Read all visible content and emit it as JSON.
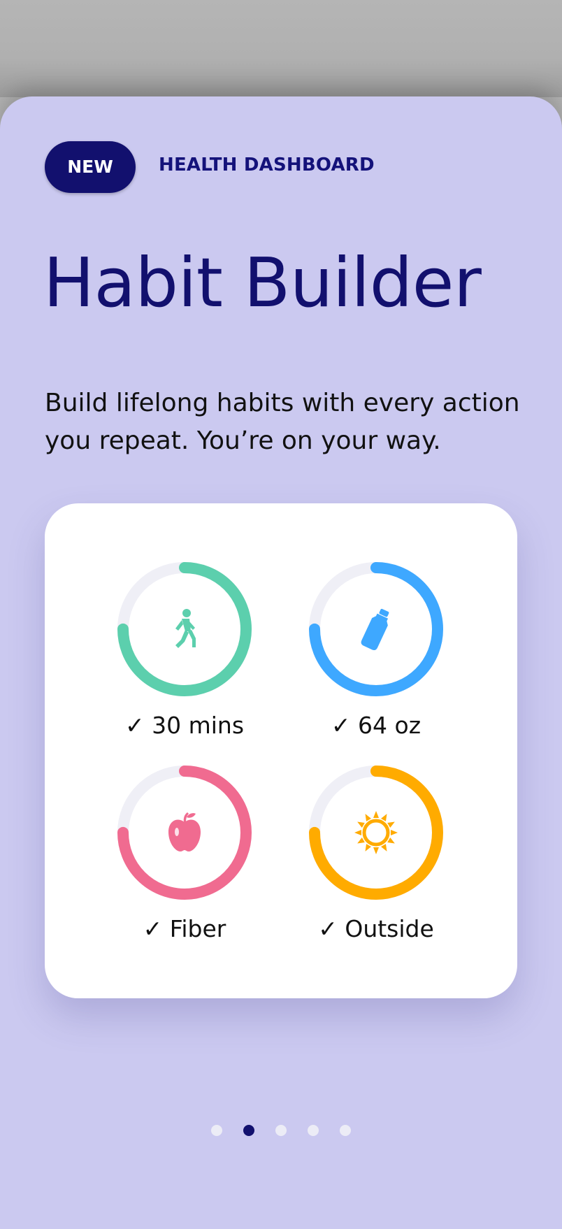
{
  "header": {
    "badge_label": "NEW",
    "eyebrow": "HEALTH DASHBOARD",
    "title": "Habit Builder",
    "subtitle": "Build lifelong habits with every action you repeat. You’re on your way."
  },
  "habits": [
    {
      "label": "✓ 30 mins",
      "icon": "walking-person-icon",
      "color": "#5ccfad",
      "progress": 0.75
    },
    {
      "label": "✓ 64 oz",
      "icon": "water-bottle-icon",
      "color": "#3ea8ff",
      "progress": 0.75
    },
    {
      "label": "✓ Fiber",
      "icon": "apple-icon",
      "color": "#f06b90",
      "progress": 0.75
    },
    {
      "label": "✓ Outside",
      "icon": "sun-icon",
      "color": "#ffab00",
      "progress": 0.75
    }
  ],
  "colors": {
    "background": "#cbc9f0",
    "accent": "#12106e",
    "ring_track": "#efeff6"
  },
  "pagination": {
    "total": 5,
    "active_index": 1
  }
}
